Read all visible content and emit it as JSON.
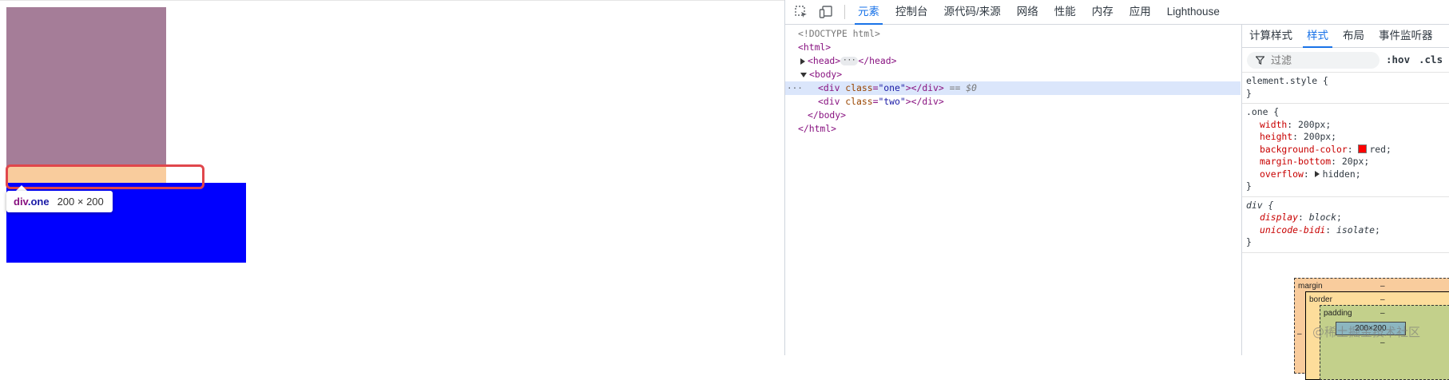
{
  "viewport": {
    "tooltip": {
      "tag": "div",
      "cls": ".one",
      "size": "200 × 200"
    }
  },
  "devtools": {
    "tabs": [
      {
        "label": "元素",
        "active": true
      },
      {
        "label": "控制台"
      },
      {
        "label": "源代码/来源"
      },
      {
        "label": "网络"
      },
      {
        "label": "性能"
      },
      {
        "label": "内存"
      },
      {
        "label": "应用"
      },
      {
        "label": "Lighthouse"
      }
    ],
    "tree": {
      "doctype": "<!DOCTYPE html>",
      "html_open": "<html>",
      "head_open": "<head>",
      "head_ellipsis": "···",
      "head_close": "</head>",
      "body_open": "<body>",
      "div_one": {
        "tag": "div",
        "attr": "class",
        "value": "\"one\"",
        "suffix": "== $0"
      },
      "div_two": {
        "tag": "div",
        "attr": "class",
        "value": "\"two\""
      },
      "body_close": "</body>",
      "html_close": "</html>",
      "selected_dots": "···"
    },
    "styles": {
      "tabs": [
        {
          "label": "计算样式"
        },
        {
          "label": "样式",
          "active": true
        },
        {
          "label": "布局"
        },
        {
          "label": "事件监听器"
        }
      ],
      "filter_placeholder": "过滤",
      "hov": ":hov",
      "cls": ".cls",
      "element_style": "element.style {",
      "close_brace": "}",
      "one_rule": {
        "selector": ".one {",
        "width": {
          "name": "width",
          "value": "200px"
        },
        "height": {
          "name": "height",
          "value": "200px"
        },
        "bg": {
          "name": "background-color",
          "value": "red",
          "swatch": "#ff0000"
        },
        "mb": {
          "name": "margin-bottom",
          "value": "20px"
        },
        "overflow": {
          "name": "overflow",
          "value": "hidden"
        }
      },
      "div_rule": {
        "selector": "div {",
        "display": {
          "name": "display",
          "value": "block"
        },
        "bidi": {
          "name": "unicode-bidi",
          "value": "isolate"
        }
      },
      "box_model": {
        "margin_label": "margin",
        "margin_top": "–",
        "margin_left": "–",
        "border_label": "border",
        "border_top": "–",
        "padding_label": "padding",
        "padding_top": "–",
        "padding_bottom": "–",
        "content": "200×200"
      },
      "watermark": "@稀土掘金技术社区"
    }
  },
  "colors": {
    "box_one": "#a57d98",
    "box_two": "#0000ff",
    "margin_highlight": "#f9cc9d",
    "accent": "#1a73e8",
    "annotation": "#e0474c"
  }
}
